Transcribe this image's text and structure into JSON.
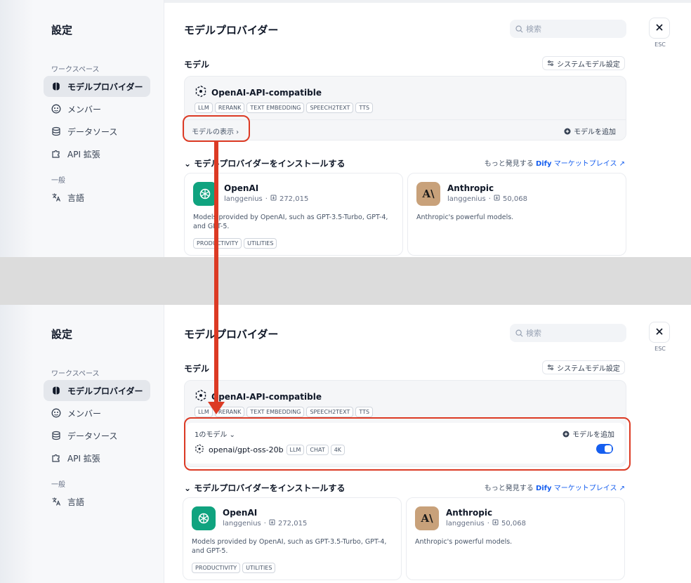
{
  "panels": [
    {
      "sidebar": {
        "title": "設定",
        "workspace_label": "ワークスペース",
        "items": [
          {
            "label": "モデルプロバイダー"
          },
          {
            "label": "メンバー"
          },
          {
            "label": "データソース"
          },
          {
            "label": "API 拡張"
          }
        ],
        "general_label": "一般",
        "language": "言語"
      },
      "header": {
        "title": "モデルプロバイダー",
        "search_placeholder": "検索",
        "esc": "ESC"
      },
      "model_section": {
        "title": "モデル",
        "system_model_button": "システムモデル設定"
      },
      "provider": {
        "name": "OpenAI-API-compatible",
        "tags": [
          "LLM",
          "RERANK",
          "TEXT EMBEDDING",
          "SPEECH2TEXT",
          "TTS"
        ],
        "show_models": "モデルの表示 ›",
        "add_model": "モデルを追加"
      },
      "install": {
        "title": "⌄ モデルプロバイダーをインストールする",
        "discover_prefix": "もっと発見する ",
        "discover_brand": "Dify",
        "discover_suffix": " マーケットプレイス ↗"
      },
      "plugins": [
        {
          "name": "OpenAI",
          "author": "langgenius",
          "installs": "272,015",
          "description": "Models provided by OpenAI, such as GPT-3.5-Turbo, GPT-4, and GPT-5.",
          "tags": [
            "PRODUCTIVITY",
            "UTILITIES"
          ]
        },
        {
          "name": "Anthropic",
          "author": "langgenius",
          "installs": "50,068",
          "description": "Anthropic's powerful models.",
          "logo_text": "A\\"
        }
      ]
    },
    {
      "sidebar": {
        "title": "設定",
        "workspace_label": "ワークスペース",
        "items": [
          {
            "label": "モデルプロバイダー"
          },
          {
            "label": "メンバー"
          },
          {
            "label": "データソース"
          },
          {
            "label": "API 拡張"
          }
        ],
        "general_label": "一般",
        "language": "言語"
      },
      "header": {
        "title": "モデルプロバイダー",
        "search_placeholder": "検索",
        "esc": "ESC"
      },
      "model_section": {
        "title": "モデル",
        "system_model_button": "システムモデル設定"
      },
      "provider": {
        "name": "OpenAI-API-compatible",
        "tags": [
          "LLM",
          "RERANK",
          "TEXT EMBEDDING",
          "SPEECH2TEXT",
          "TTS"
        ],
        "model_count": "1のモデル ⌄",
        "add_model": "モデルを追加",
        "model": {
          "name": "openai/gpt-oss-20b",
          "tags": [
            "LLM",
            "CHAT",
            "4K"
          ],
          "enabled": true
        }
      },
      "install": {
        "title": "⌄ モデルプロバイダーをインストールする",
        "discover_prefix": "もっと発見する ",
        "discover_brand": "Dify",
        "discover_suffix": " マーケットプレイス ↗"
      },
      "plugins": [
        {
          "name": "OpenAI",
          "author": "langgenius",
          "installs": "272,015",
          "description": "Models provided by OpenAI, such as GPT-3.5-Turbo, GPT-4, and GPT-5.",
          "tags": [
            "PRODUCTIVITY",
            "UTILITIES"
          ]
        },
        {
          "name": "Anthropic",
          "author": "langgenius",
          "installs": "50,068",
          "description": "Anthropic's powerful models.",
          "logo_text": "A\\"
        }
      ]
    }
  ],
  "colors": {
    "accent": "#155eef",
    "annotation": "#dc3a24",
    "openai_logo": "#10a37f",
    "anthropic_logo": "#c8a17a"
  }
}
